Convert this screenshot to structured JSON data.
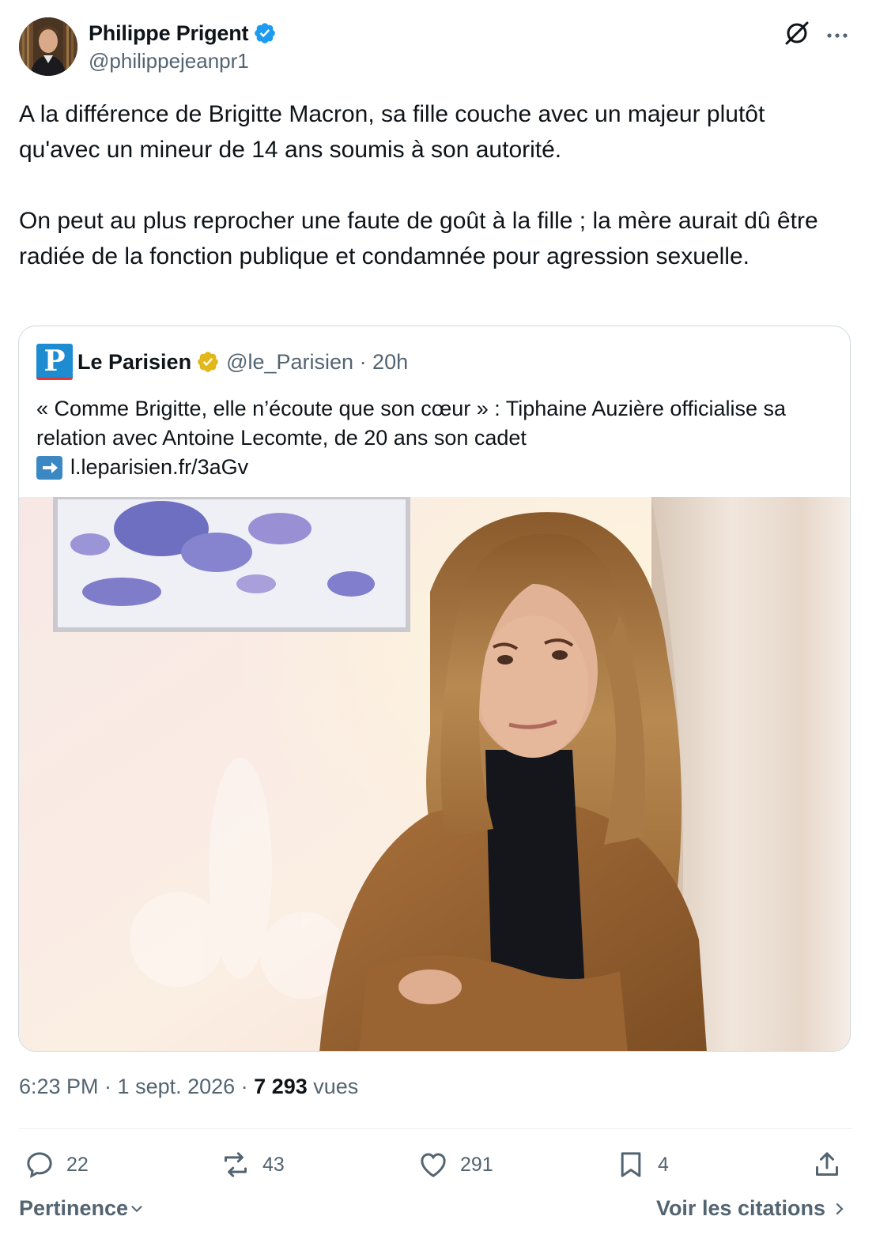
{
  "author": {
    "display_name": "Philippe Prigent",
    "handle": "@philippejeanpr1"
  },
  "tweet": {
    "paragraph_1": "A la différence de Brigitte Macron, sa fille couche avec un majeur plutôt qu'avec un mineur de 14 ans soumis à son autorité.",
    "paragraph_2": "On peut au plus reprocher une faute de goût à la fille ; la mère aurait dû être radiée de la fonction publique et condamnée pour agression sexuelle."
  },
  "quote": {
    "logo_letter": "P",
    "name": "Le Parisien",
    "handle_time": "@le_Parisien · 20h",
    "text": "« Comme Brigitte, elle n’écoute que son cœur » : Tiphaine Auzière officialise sa relation avec Antoine Lecomte, de 20 ans son cadet",
    "link": "l.leparisien.fr/3aGv"
  },
  "meta": {
    "time_date": "6:23 PM · 1 sept. 2026 · ",
    "views_count": "7 293",
    "views_label": " vues"
  },
  "actions": {
    "replies": "22",
    "reposts": "43",
    "likes": "291",
    "bookmarks": "4"
  },
  "footer": {
    "sort_label": "Pertinence",
    "quotes_link": "Voir les citations"
  },
  "colors": {
    "text": "#0f1419",
    "secondary": "#536471",
    "verified_blue": "#1d9bf0",
    "verified_gold": "#e2b719",
    "border": "#cfd9de"
  },
  "icons": [
    "verified-icon",
    "grok-icon",
    "more-icon",
    "gold-verified-icon",
    "arrow-right-emoji",
    "reply-icon",
    "repost-icon",
    "like-icon",
    "bookmark-icon",
    "share-icon",
    "chevron-down-icon",
    "chevron-right-icon"
  ]
}
